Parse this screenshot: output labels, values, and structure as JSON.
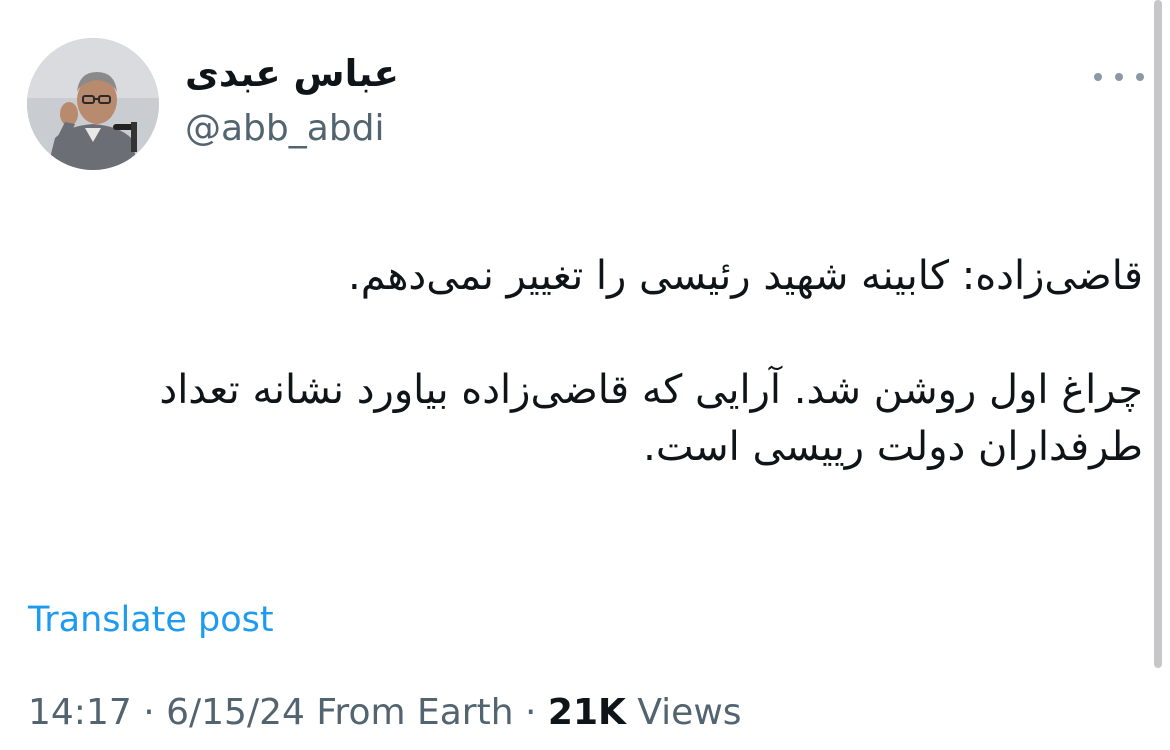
{
  "author": {
    "display_name": "عباس عبدی",
    "handle": "@abb_abdi"
  },
  "post": {
    "paragraphs": [
      "قاضی‌زاده: کابینه شهید رئیسی را تغییر نمی‌دهم.",
      "چراغ اول روشن شد. آرایی که قاضی‌زاده بیاورد نشانه تعداد طرفداران دولت رییسی است."
    ],
    "translate_label": "Translate post"
  },
  "meta": {
    "time": "14:17",
    "separator": "·",
    "date": "6/15/24",
    "location": "From Earth",
    "views_count": "21K",
    "views_label": "Views"
  },
  "icons": {
    "more": "more-horizontal-icon",
    "avatar": "avatar-photo"
  },
  "colors": {
    "text_primary": "#0f1419",
    "text_secondary": "#536471",
    "link": "#1d9bf0"
  }
}
